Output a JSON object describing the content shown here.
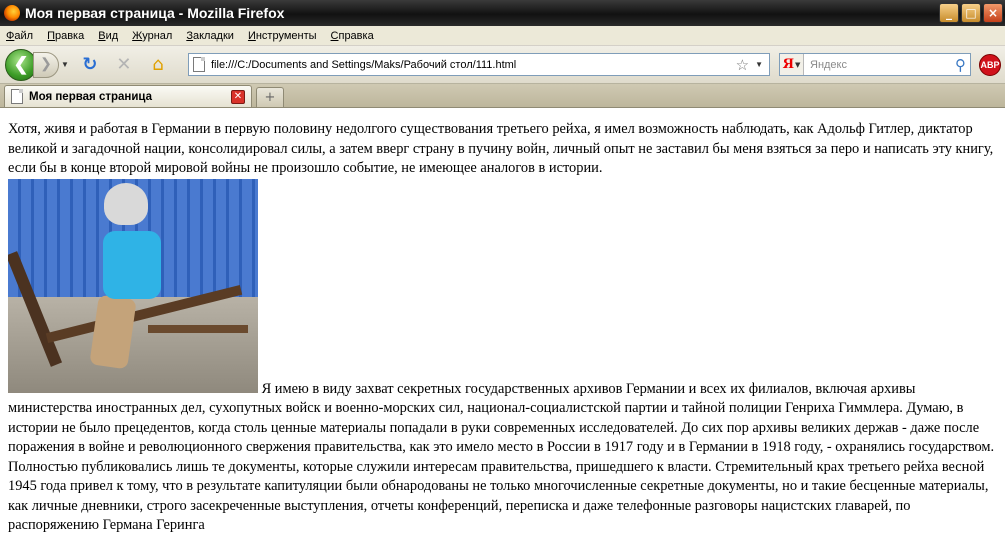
{
  "window": {
    "title": "Моя первая страница - Mozilla Firefox",
    "buttons": {
      "minimize": "_",
      "maximize": "□",
      "close": "×"
    }
  },
  "menu": [
    "Файл",
    "Правка",
    "Вид",
    "Журнал",
    "Закладки",
    "Инструменты",
    "Справка"
  ],
  "nav": {
    "url": "file:///C:/Documents and Settings/Maks/Рабочий стол/111.html",
    "search_placeholder": "Яндекс",
    "search_engine": "Я",
    "addon_label": "ABP"
  },
  "tabs": [
    {
      "label": "Моя первая страница",
      "active": true
    }
  ],
  "page": {
    "paragraph1": "Хотя, живя и работая в Германии в первую половину недолгого существования третьего рейха, я имел возможность наблюдать, как Адольф Гитлер, диктатор великой и загадочной нации, консолидировал силы, а затем вверг страну в пучину войн, личный опыт не заставил бы меня взяться за перо и написать эту книгу, если бы в конце второй мировой войны не произошло событие, не имеющее аналогов в истории.",
    "paragraph2": " Я имею в виду захват секретных государственных архивов Германии и всех их филиалов, включая архивы министерства иностранных дел, сухопутных войск и военно-морских сил, национал-социалистской партии и тайной полиции Генриха Гиммлера. Думаю, в истории не было прецедентов, когда столь ценные материалы попадали в руки современных исследователей. До сих пор архивы великих держав - даже после поражения в войне и революционного свержения правительства, как это имело место в России в 1917 году и в Германии в 1918 году, - охранялись государством. Полностью публиковались лишь те документы, которые служили интересам правительства, пришедшего к власти. Стремительный крах третьего рейха весной 1945 года привел к тому, что в результате капитуляции были обнародованы не только многочисленные секретные документы, но и такие бесценные материалы, как личные дневники, строго засекреченные выступления, отчеты конференций, переписка и даже телефонные разговоры нацистских главарей, по распоряжению Германа Геринга"
  }
}
